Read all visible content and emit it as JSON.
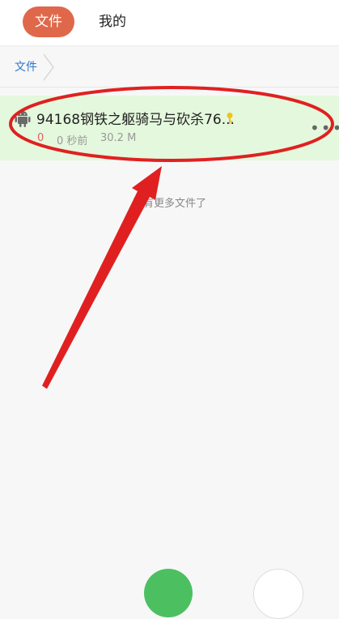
{
  "tabs": {
    "active": "文件",
    "other": "我的"
  },
  "breadcrumb": {
    "label": "文件"
  },
  "file": {
    "name": "94168钢铁之躯骑马与砍杀76...",
    "count": "0",
    "time": "0 秒前",
    "size": "30.2 M",
    "icon": "android-icon",
    "key_icon": "key-icon",
    "more_icon": "more-icon"
  },
  "empty_message": "没有更多文件了",
  "colors": {
    "accent": "#e0684a",
    "highlight_row": "#e4f8dd",
    "annotation_red": "#e02020",
    "fab_green": "#4cc061"
  }
}
